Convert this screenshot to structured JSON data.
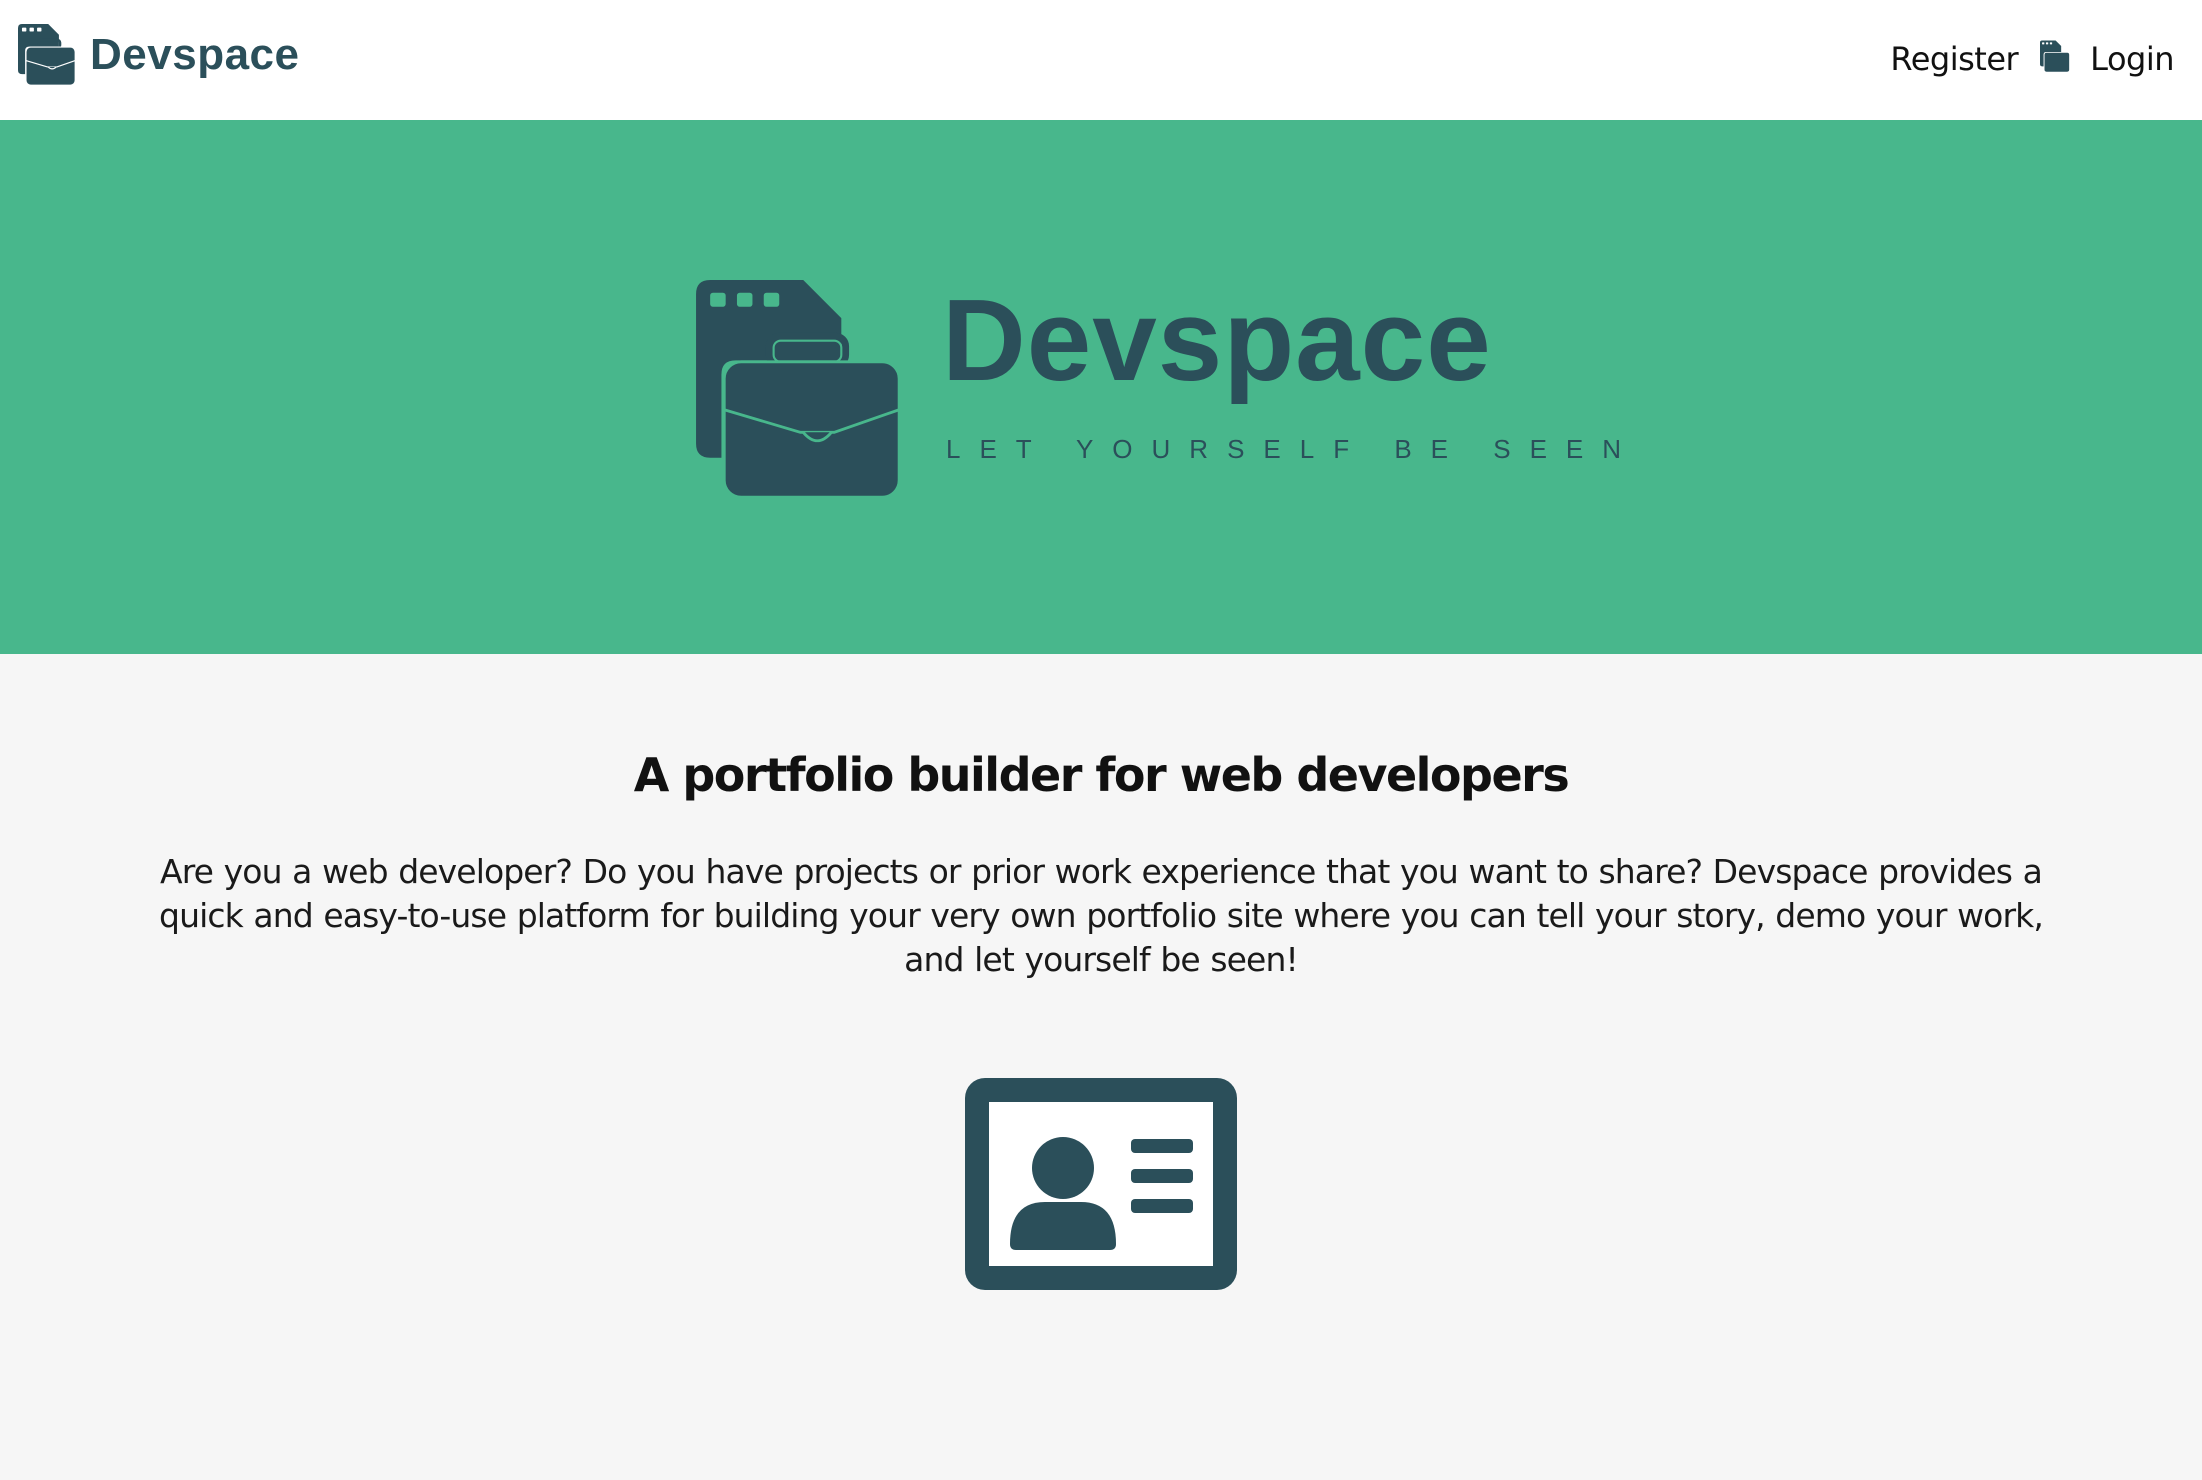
{
  "navbar": {
    "brand_name": "Devspace",
    "brand_icon": "briefcase-window-icon",
    "register_label": "Register",
    "login_icon": "briefcase-window-icon",
    "login_label": "Login"
  },
  "hero": {
    "logo_icon": "briefcase-window-icon",
    "title": "Devspace",
    "tagline": "LET YOURSELF BE SEEN"
  },
  "main": {
    "headline": "A portfolio builder for web developers",
    "description": "Are you a web developer?   Do you have projects or prior work experience that you want to share?   Devspace provides a quick and easy-to-use platform for building your very own portfolio site where you can tell your story, demo your work, and let yourself be seen!",
    "feature_icon": "id-card-icon"
  },
  "colors": {
    "brand_dark": "#2b4f5a",
    "hero_green": "#48b78c",
    "page_background": "#f6f6f6",
    "navbar_background": "#ffffff"
  }
}
